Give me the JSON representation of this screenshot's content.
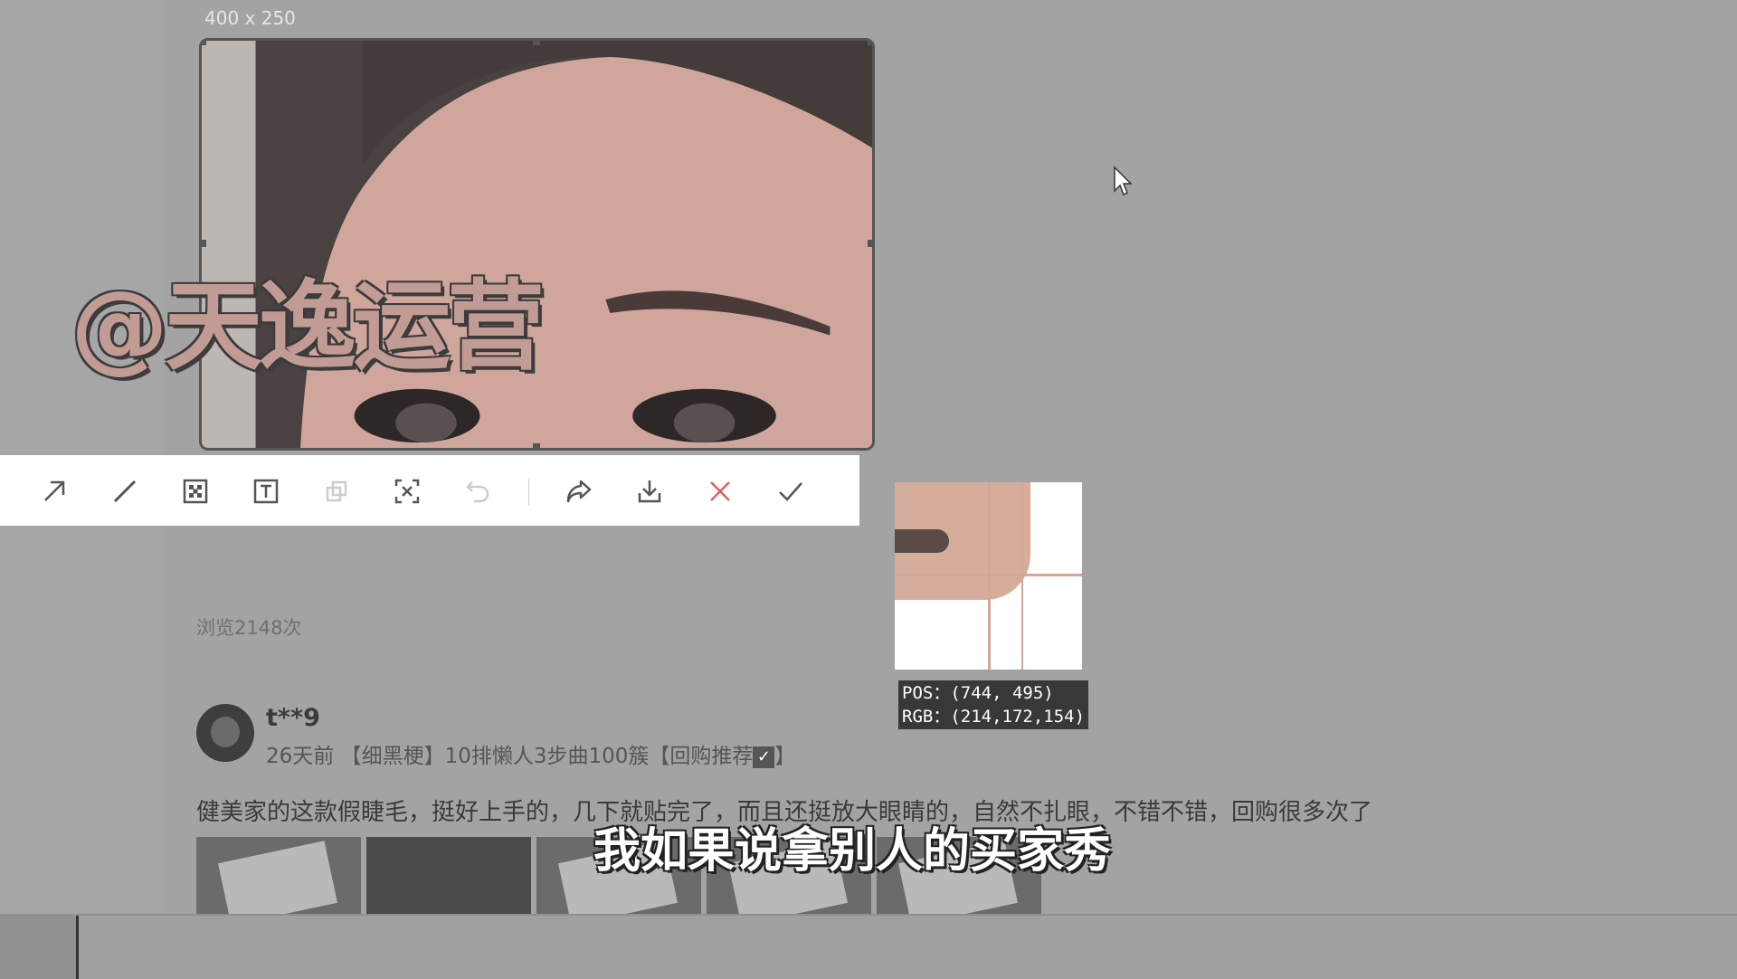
{
  "screenshot_tool": {
    "selection_size": "400 x 250",
    "toolbar": [
      {
        "name": "arrow-tool-icon"
      },
      {
        "name": "pen-tool-icon"
      },
      {
        "name": "mosaic-tool-icon"
      },
      {
        "name": "text-tool-icon"
      },
      {
        "name": "pin-tool-icon"
      },
      {
        "name": "ocr-tool-icon"
      },
      {
        "name": "undo-icon"
      },
      {
        "name": "share-icon"
      },
      {
        "name": "download-icon"
      },
      {
        "name": "cancel-icon"
      },
      {
        "name": "confirm-icon"
      }
    ],
    "magnifier": {
      "pos": "POS：(744, 495)",
      "rgb": "RGB：(214,172,154)"
    }
  },
  "watermark": "@天逸运营",
  "page": {
    "views": "浏览2148次",
    "review": {
      "username": "t**9",
      "meta": "26天前 【细黑梗】10排懒人3步曲100簇【回购推荐",
      "meta_end": "】",
      "text": "健美家的这款假睫毛，挺好上手的，几下就贴完了，而且还挺放大眼睛的，自然不扎眼，不错不错，回购很多次了"
    }
  },
  "subtitle": "我如果说拿别人的买家秀",
  "colors": {
    "accent_red": "#e06060",
    "toolbar_icon": "#555555",
    "magnifier_pink": "#d6ac9a"
  }
}
